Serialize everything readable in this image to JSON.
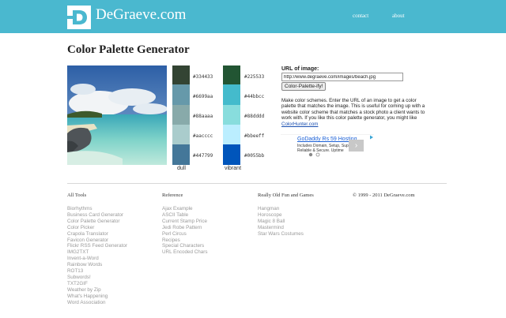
{
  "header": {
    "logo_letter": "D",
    "site_name": "DeGraeve.com",
    "nav": [
      "contact",
      "about"
    ],
    "bar_color": "#4ab8cf"
  },
  "page": {
    "title": "Color Palette Generator"
  },
  "palette": {
    "dull": {
      "label": "dull",
      "colors": [
        "#334433",
        "#6699aa",
        "#88aaaa",
        "#aacccc",
        "#447799"
      ]
    },
    "vibrant": {
      "label": "vibrant",
      "colors": [
        "#225533",
        "#44bbcc",
        "#88dddd",
        "#bbeeff",
        "#0055bb"
      ]
    }
  },
  "form": {
    "url_label": "URL of image:",
    "url_value": "http://www.degraeve.com/images/beach.jpg",
    "submit_label": "Color-Palette-ify!"
  },
  "description": {
    "text": "Make color schemes. Enter the URL of an image to get a color palette that matches the image. This is useful for coming up with a website color scheme that matches a stock photo a client wants to work with. If you like this color palette generator, you might like ",
    "link": "ColorHunter.com"
  },
  "ad": {
    "title": "GoDaddy Rs 59 Hosting",
    "line1": "Includes Domain, Setup, Support,",
    "line2": "Reliable & Secure. Uptime",
    "arrow": "›"
  },
  "footer": {
    "columns": [
      {
        "heading": "All Tools",
        "items": [
          "Biorhythms",
          "Business Card Generator",
          "Color Palette Generator",
          "Color Picker",
          "Crapola Translator",
          "Favicon Generator",
          "Flickr RSS Feed Generator",
          "IMG2TXT",
          "Invent-a-Word",
          "Rainbow Words",
          "ROT13",
          "Subwords!",
          "TXT2GIF",
          "Weather by Zip",
          "What's Happening",
          "Word Association"
        ]
      },
      {
        "heading": "Reference",
        "items": [
          "Ajax Example",
          "ASCII Table",
          "Current Stamp Price",
          "Jedi Robe Pattern",
          "Perl Circus",
          "Recipes",
          "Special Characters",
          "URL Encoded Chars"
        ]
      },
      {
        "heading": "Really Old Fun and Games",
        "items": [
          "Hangman",
          "Horoscope",
          "Magic 8 Ball",
          "Mastermind",
          "Star Wars Costumes"
        ]
      }
    ],
    "copyright": "© 1999 - 2011 DeGraeve.com"
  }
}
